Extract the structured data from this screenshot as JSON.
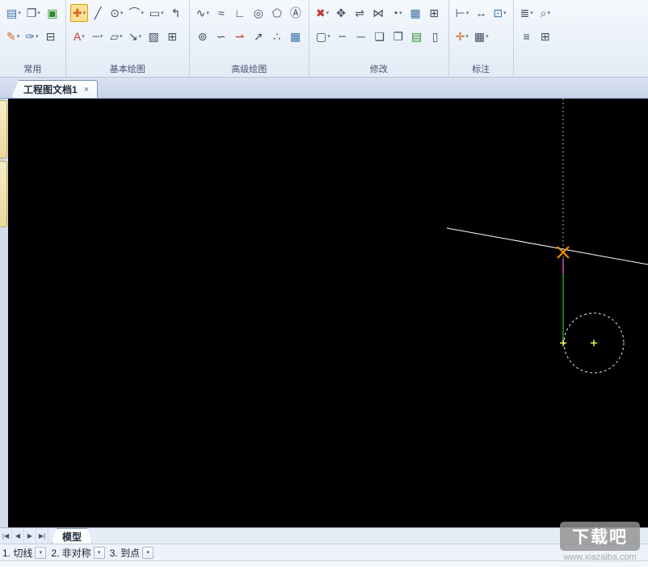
{
  "ribbon": {
    "groups": {
      "common": {
        "label": "常用"
      },
      "basic": {
        "label": "基本绘图"
      },
      "advanced": {
        "label": "高级绘图"
      },
      "modify": {
        "label": "修改"
      },
      "annotate": {
        "label": "标注"
      },
      "view": {
        "label": ""
      }
    }
  },
  "icons": {
    "dropdown": "▾",
    "paste": "▤",
    "copy": "❐",
    "new_sheet": "▣",
    "format_brush": "✎",
    "pen": "✑",
    "save": "⊟",
    "line_tool": "✚",
    "segment": "╱",
    "circle": "⊙",
    "arc": "⌒",
    "rect": "▭",
    "polyline": "↰",
    "text": "A",
    "dashed_line": "┄",
    "shapes": "▱",
    "leader": "↘",
    "hatch": "▨",
    "block": "⊞",
    "spline": "∿",
    "curve": "≈",
    "angle_line": "∟",
    "ellipse": "◎",
    "polygon": "⬠",
    "circle_a": "Ⓐ",
    "wave": "⊚",
    "squiggle": "∽",
    "ray": "⇀",
    "arrow_up": "↗",
    "points": "∴",
    "table": "▦",
    "erase": "✖",
    "move": "✥",
    "offset": "⇌",
    "mirror": "⋈",
    "rotate": "◔",
    "array": "▦",
    "copy_obj": "⊞",
    "stretch": "▢",
    "break": "╌",
    "join": "─",
    "doc": "❏",
    "doc2": "❐",
    "paste2": "▤",
    "bar": "▯",
    "dim": "⊢",
    "dim_linear": "↔",
    "screen": "⊡",
    "dim_style": "✛",
    "grid": "▦",
    "list": "≣",
    "zoom": "⌕",
    "menu": "≡",
    "pan": "⊞"
  },
  "document_tab": {
    "label": "工程图文档1",
    "close": "×"
  },
  "nav": {
    "first": "|◀",
    "prev": "◀",
    "next": "▶",
    "last": "▶|"
  },
  "model_tab": {
    "label": "模型"
  },
  "status_combos": [
    {
      "label": "1. 切线"
    },
    {
      "label": "2. 非对称"
    },
    {
      "label": "3. 到点"
    }
  ],
  "watermark": {
    "title": "下载吧",
    "url": "www.xiazaiba.com"
  },
  "colors": {
    "canvas_bg": "#000000",
    "snap_marker": "#f08c00",
    "guide_green": "#18a818",
    "guide_magenta": "#c94fc9",
    "endpoint_yellow": "#ffff55",
    "tool_highlight": "#fbe195"
  }
}
